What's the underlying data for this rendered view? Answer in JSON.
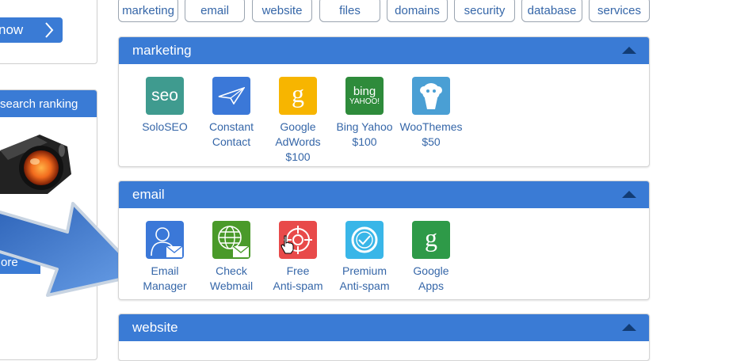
{
  "promo_top": {
    "button_label": "now"
  },
  "promo_side": {
    "heading": "search ranking",
    "button_label": "ore"
  },
  "tags": [
    "marketing",
    "email",
    "website",
    "files",
    "domains",
    "security",
    "database",
    "services"
  ],
  "panels": {
    "marketing": {
      "title": "marketing",
      "apps": [
        {
          "name": "SoloSEO",
          "line2": "",
          "line3": "",
          "icon": "seo-icon",
          "color": "#3f9b8f",
          "glyph": "seo"
        },
        {
          "name": "Constant",
          "line2": "Contact",
          "line3": "",
          "icon": "paper-plane-icon",
          "color": "#3b78d8"
        },
        {
          "name": "Google",
          "line2": "AdWords",
          "line3": "$100",
          "icon": "google-g-icon",
          "color": "#f7b500",
          "glyph": "g"
        },
        {
          "name": "Bing Yahoo",
          "line2": "$100",
          "line3": "",
          "icon": "bing-yahoo-icon",
          "color": "#2e8b3b",
          "glyph_top": "bing",
          "glyph_bottom": "YAHOO!"
        },
        {
          "name": "WooThemes",
          "line2": "$50",
          "line3": "",
          "icon": "woothemes-icon",
          "color": "#4a9fd4"
        }
      ]
    },
    "email": {
      "title": "email",
      "apps": [
        {
          "name": "Email",
          "line2": "Manager",
          "icon": "email-manager-icon",
          "color": "#3b78d8"
        },
        {
          "name": "Check",
          "line2": "Webmail",
          "icon": "webmail-globe-icon",
          "color": "#4a9a2a"
        },
        {
          "name": "Free",
          "line2": "Anti-spam",
          "icon": "anti-spam-target-icon",
          "color": "#e84a4a"
        },
        {
          "name": "Premium",
          "line2": "Anti-spam",
          "icon": "premium-anti-spam-icon",
          "color": "#39b6e8"
        },
        {
          "name": "Google",
          "line2": "Apps",
          "icon": "google-apps-icon",
          "color": "#2e9a48",
          "glyph": "g"
        }
      ]
    },
    "website": {
      "title": "website"
    }
  }
}
